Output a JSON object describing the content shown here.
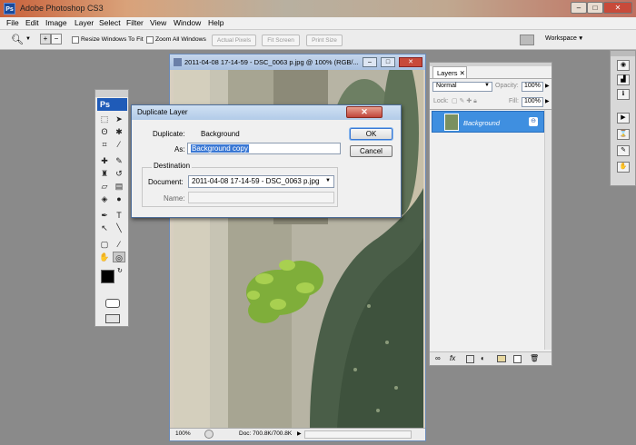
{
  "app": {
    "title": "Adobe Photoshop CS3",
    "icon": "photoshop-icon"
  },
  "menu": [
    "File",
    "Edit",
    "Image",
    "Layer",
    "Select",
    "Filter",
    "View",
    "Window",
    "Help"
  ],
  "options_bar": {
    "resize_windows_label": "Resize Windows To Fit",
    "zoom_all_label": "Zoom All Windows",
    "actual_pixels": "Actual Pixels",
    "fit_screen": "Fit Screen",
    "print_size": "Print Size",
    "workspace": "Workspace"
  },
  "document": {
    "title": "2011-04-08 17-14-59 - DSC_0063 p.jpg @ 100% (RGB/...",
    "zoom": "100%",
    "doc_size": "Doc: 700.8K/700.8K"
  },
  "toolbox": {
    "logo": "Ps"
  },
  "layers_panel": {
    "tab": "Layers",
    "blend_mode": "Normal",
    "opacity_label": "Opacity:",
    "opacity_value": "100%",
    "lock_label": "Lock:",
    "fill_label": "Fill:",
    "fill_value": "100%",
    "layer_name": "Background"
  },
  "dialog": {
    "title": "Duplicate Layer",
    "duplicate_label": "Duplicate:",
    "duplicate_value": "Background",
    "as_label": "As:",
    "as_value": "Background copy",
    "ok": "OK",
    "cancel": "Cancel",
    "destination_label": "Destination",
    "document_label": "Document:",
    "document_value": "2011-04-08 17-14-59 - DSC_0063 p.jpg",
    "name_label": "Name:",
    "name_value": ""
  }
}
